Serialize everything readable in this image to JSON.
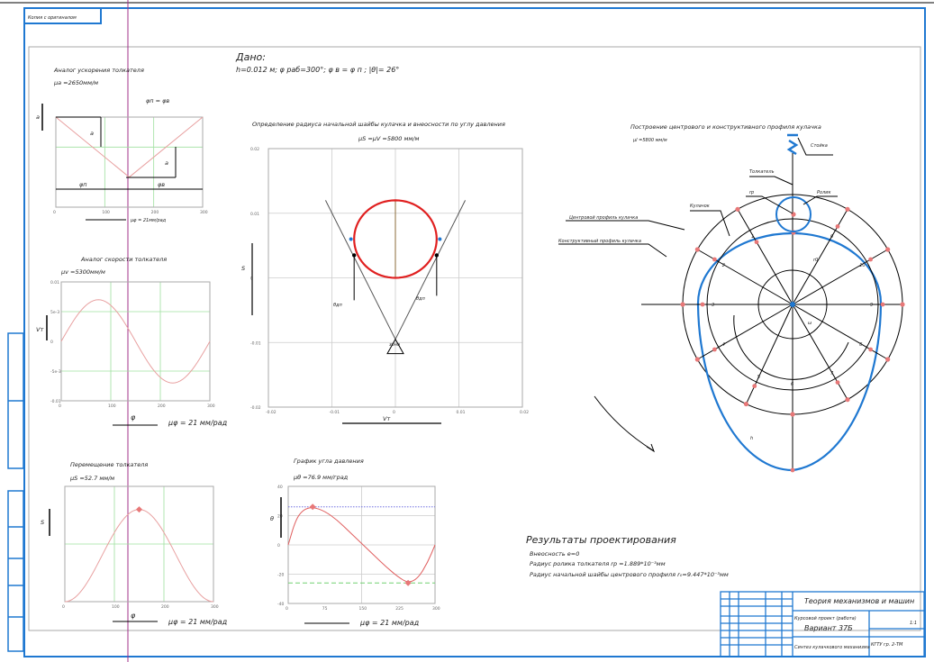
{
  "sheet": {
    "corner_label": "Копия с оригиналом",
    "given_title": "Дано:",
    "given_values": "h=0.012 м; φ раб=300°; φ в = φ п ; |θ|= 26°"
  },
  "accel": {
    "title": "Аналог ускорения толкателя",
    "scale": "μa =2650мм/м",
    "note": "φп = φв",
    "a_label": "a",
    "phi_label_1": "φп",
    "phi_label_2": "φв",
    "axis_y": "a",
    "phi_scale": "μφ = 21мм/рад"
  },
  "velocity": {
    "title": "Аналог скорости толкателя",
    "scale": "μv =5300мм/м",
    "axis_y": "Vт",
    "axis_x": "φ",
    "phi_scale": "μφ = 21 мм/рад"
  },
  "displacement": {
    "title": "Перемещение толкателя",
    "scale": "μS =52.7 мм/м",
    "axis_y": "S",
    "axis_x": "φ",
    "phi_scale": "μφ = 21 мм/рад"
  },
  "pressure": {
    "title": "График угла давления",
    "scale": "μθ =76.9 мм/град",
    "axis_y": "θ",
    "phi_scale": "μφ = 21 мм/рад"
  },
  "radius_plot": {
    "title": "Определение радиуса начальной шайбы кулачка и внеосности по углу давления",
    "scale": "μS =μV =5800 мм/м",
    "axis_y": "S",
    "axis_x": "Vт",
    "theta_1": "θдп",
    "theta_2": "θдп",
    "zone": "зона"
  },
  "cam": {
    "title": "Построение центрового и конструктивного профиля кулачка",
    "scale": "μl =5800 мм/м",
    "labels": {
      "stand": "Стойка",
      "follower": "Толкатель",
      "roller_radius": "rр",
      "roller": "Ролик",
      "cam": "Кулачок",
      "center_profile": "Центровой профиль кулачка",
      "design_profile": "Конструктивный профиль кулачка",
      "r0": "r0",
      "h": "h",
      "w": "ω"
    },
    "points": [
      "1",
      "2",
      "3",
      "4",
      "5",
      "6",
      "7",
      "8",
      "9",
      "10",
      "0"
    ]
  },
  "results": {
    "title": "Результаты проектирования",
    "lines": [
      "Внеосность e=0",
      "Радиус ролика толкателя rр =1.889*10⁻³мм",
      "Радиус начальной шайбы центрового профиля r₀=9.447*10⁻³мм"
    ]
  },
  "title_block": {
    "discipline": "Теория механизмов и машин",
    "work": "Курсовой проект (работа)",
    "variant": "Вариант 37Б",
    "topic": "Синтез кулачкового механизма",
    "sheet": "1:1",
    "group": "КГТУ гр. 2-ТМ"
  },
  "chart_data": [
    {
      "type": "line",
      "title": "Аналог ускорения толкателя",
      "xlabel": "φ",
      "ylabel": "a",
      "xlim": [
        0,
        300
      ],
      "ylim": [
        -0.02,
        0.01
      ],
      "x": [
        0,
        150,
        300
      ],
      "values": [
        0.01,
        -0.01,
        0.01
      ],
      "xticks": [
        "0",
        "100",
        "200",
        "300"
      ]
    },
    {
      "type": "line",
      "title": "Аналог скорости толкателя",
      "xlabel": "φ",
      "ylabel": "Vт",
      "xlim": [
        0,
        300
      ],
      "ylim": [
        -0.01,
        0.01
      ],
      "function": "0.007*sin(2πφ/300)",
      "xticks": [
        "0",
        "100",
        "200",
        "300"
      ],
      "yticks": [
        "0.01",
        "5e-3",
        "0",
        "-5e-3",
        "-0.01"
      ]
    },
    {
      "type": "line",
      "title": "Перемещение толкателя",
      "xlabel": "φ",
      "ylabel": "S",
      "xlim": [
        0,
        300
      ],
      "ylim": [
        0,
        0.015
      ],
      "function": "0.012*(1-cos(2πφ/300))/2",
      "max_point": [
        150,
        0.012
      ],
      "xticks": [
        "0",
        "100",
        "200",
        "300"
      ]
    },
    {
      "type": "line",
      "title": "График угла давления",
      "xlabel": "φ",
      "ylabel": "θ",
      "xlim": [
        0,
        300
      ],
      "ylim": [
        -40,
        40
      ],
      "x": [
        0,
        15,
        30,
        50,
        75,
        100,
        125,
        150,
        175,
        200,
        225,
        245,
        265,
        285,
        300
      ],
      "values": [
        0,
        17,
        24,
        26,
        23,
        17,
        9,
        1,
        -7,
        -15,
        -22,
        -26,
        -23,
        -12,
        0
      ],
      "limits": [
        26,
        -26
      ],
      "xticks": [
        "0",
        "75",
        "150",
        "225",
        "300"
      ],
      "yticks": [
        "40",
        "20",
        "0",
        "-20",
        "-40"
      ]
    },
    {
      "type": "line",
      "title": "Определение радиуса начальной шайбы",
      "xlabel": "Vт",
      "ylabel": "S",
      "xlim": [
        -0.02,
        0.02
      ],
      "ylim": [
        -0.02,
        0.02
      ],
      "xticks": [
        "-0.02",
        "-0.01",
        "0",
        "0.01",
        "0.02"
      ],
      "yticks": [
        "0.02",
        "0.01",
        "0",
        "-0.01",
        "-0.02"
      ]
    }
  ]
}
